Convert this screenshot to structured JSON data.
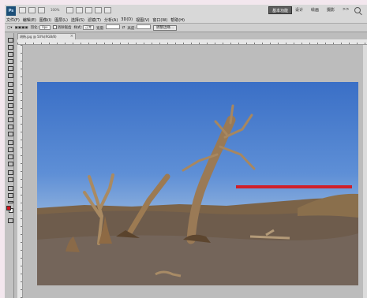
{
  "topbar": {
    "app_logo": "Ps",
    "zoom": "100%",
    "workspaces": [
      "基本功能",
      "设计",
      "绘画",
      "摄影"
    ],
    "more_label": ">>",
    "search_icon": "search-icon"
  },
  "menu": [
    "文件(F)",
    "编辑(E)",
    "图像(I)",
    "图层(L)",
    "选择(S)",
    "滤镜(T)",
    "分析(A)",
    "3D(D)",
    "视图(V)",
    "窗口(W)",
    "帮助(H)"
  ],
  "options": {
    "feather_label": "羽化:",
    "feather_value": "0px",
    "antialias_label": "消除锯齿",
    "style_label": "样式:",
    "style_value": "正常",
    "width_label": "宽度:",
    "height_label": "高度:",
    "refine_label": "调整边缘..."
  },
  "document": {
    "tab_title": "胡杨.jpg @ 50%(RGB/8)",
    "close_glyph": "×"
  },
  "toolbox": {
    "foreground_color": "#d0121c",
    "background_color": "#ffffff"
  },
  "overlay": {
    "red_line_color": "#d0202a"
  }
}
